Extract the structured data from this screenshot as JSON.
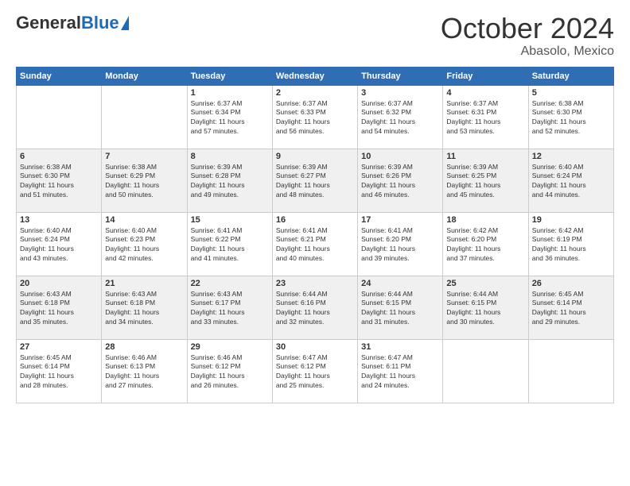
{
  "header": {
    "logo": {
      "general": "General",
      "blue": "Blue"
    },
    "title": "October 2024",
    "location": "Abasolo, Mexico"
  },
  "calendar": {
    "days_of_week": [
      "Sunday",
      "Monday",
      "Tuesday",
      "Wednesday",
      "Thursday",
      "Friday",
      "Saturday"
    ],
    "weeks": [
      [
        {
          "day": "",
          "info": ""
        },
        {
          "day": "",
          "info": ""
        },
        {
          "day": "1",
          "info": "Sunrise: 6:37 AM\nSunset: 6:34 PM\nDaylight: 11 hours\nand 57 minutes."
        },
        {
          "day": "2",
          "info": "Sunrise: 6:37 AM\nSunset: 6:33 PM\nDaylight: 11 hours\nand 56 minutes."
        },
        {
          "day": "3",
          "info": "Sunrise: 6:37 AM\nSunset: 6:32 PM\nDaylight: 11 hours\nand 54 minutes."
        },
        {
          "day": "4",
          "info": "Sunrise: 6:37 AM\nSunset: 6:31 PM\nDaylight: 11 hours\nand 53 minutes."
        },
        {
          "day": "5",
          "info": "Sunrise: 6:38 AM\nSunset: 6:30 PM\nDaylight: 11 hours\nand 52 minutes."
        }
      ],
      [
        {
          "day": "6",
          "info": "Sunrise: 6:38 AM\nSunset: 6:30 PM\nDaylight: 11 hours\nand 51 minutes."
        },
        {
          "day": "7",
          "info": "Sunrise: 6:38 AM\nSunset: 6:29 PM\nDaylight: 11 hours\nand 50 minutes."
        },
        {
          "day": "8",
          "info": "Sunrise: 6:39 AM\nSunset: 6:28 PM\nDaylight: 11 hours\nand 49 minutes."
        },
        {
          "day": "9",
          "info": "Sunrise: 6:39 AM\nSunset: 6:27 PM\nDaylight: 11 hours\nand 48 minutes."
        },
        {
          "day": "10",
          "info": "Sunrise: 6:39 AM\nSunset: 6:26 PM\nDaylight: 11 hours\nand 46 minutes."
        },
        {
          "day": "11",
          "info": "Sunrise: 6:39 AM\nSunset: 6:25 PM\nDaylight: 11 hours\nand 45 minutes."
        },
        {
          "day": "12",
          "info": "Sunrise: 6:40 AM\nSunset: 6:24 PM\nDaylight: 11 hours\nand 44 minutes."
        }
      ],
      [
        {
          "day": "13",
          "info": "Sunrise: 6:40 AM\nSunset: 6:24 PM\nDaylight: 11 hours\nand 43 minutes."
        },
        {
          "day": "14",
          "info": "Sunrise: 6:40 AM\nSunset: 6:23 PM\nDaylight: 11 hours\nand 42 minutes."
        },
        {
          "day": "15",
          "info": "Sunrise: 6:41 AM\nSunset: 6:22 PM\nDaylight: 11 hours\nand 41 minutes."
        },
        {
          "day": "16",
          "info": "Sunrise: 6:41 AM\nSunset: 6:21 PM\nDaylight: 11 hours\nand 40 minutes."
        },
        {
          "day": "17",
          "info": "Sunrise: 6:41 AM\nSunset: 6:20 PM\nDaylight: 11 hours\nand 39 minutes."
        },
        {
          "day": "18",
          "info": "Sunrise: 6:42 AM\nSunset: 6:20 PM\nDaylight: 11 hours\nand 37 minutes."
        },
        {
          "day": "19",
          "info": "Sunrise: 6:42 AM\nSunset: 6:19 PM\nDaylight: 11 hours\nand 36 minutes."
        }
      ],
      [
        {
          "day": "20",
          "info": "Sunrise: 6:43 AM\nSunset: 6:18 PM\nDaylight: 11 hours\nand 35 minutes."
        },
        {
          "day": "21",
          "info": "Sunrise: 6:43 AM\nSunset: 6:18 PM\nDaylight: 11 hours\nand 34 minutes."
        },
        {
          "day": "22",
          "info": "Sunrise: 6:43 AM\nSunset: 6:17 PM\nDaylight: 11 hours\nand 33 minutes."
        },
        {
          "day": "23",
          "info": "Sunrise: 6:44 AM\nSunset: 6:16 PM\nDaylight: 11 hours\nand 32 minutes."
        },
        {
          "day": "24",
          "info": "Sunrise: 6:44 AM\nSunset: 6:15 PM\nDaylight: 11 hours\nand 31 minutes."
        },
        {
          "day": "25",
          "info": "Sunrise: 6:44 AM\nSunset: 6:15 PM\nDaylight: 11 hours\nand 30 minutes."
        },
        {
          "day": "26",
          "info": "Sunrise: 6:45 AM\nSunset: 6:14 PM\nDaylight: 11 hours\nand 29 minutes."
        }
      ],
      [
        {
          "day": "27",
          "info": "Sunrise: 6:45 AM\nSunset: 6:14 PM\nDaylight: 11 hours\nand 28 minutes."
        },
        {
          "day": "28",
          "info": "Sunrise: 6:46 AM\nSunset: 6:13 PM\nDaylight: 11 hours\nand 27 minutes."
        },
        {
          "day": "29",
          "info": "Sunrise: 6:46 AM\nSunset: 6:12 PM\nDaylight: 11 hours\nand 26 minutes."
        },
        {
          "day": "30",
          "info": "Sunrise: 6:47 AM\nSunset: 6:12 PM\nDaylight: 11 hours\nand 25 minutes."
        },
        {
          "day": "31",
          "info": "Sunrise: 6:47 AM\nSunset: 6:11 PM\nDaylight: 11 hours\nand 24 minutes."
        },
        {
          "day": "",
          "info": ""
        },
        {
          "day": "",
          "info": ""
        }
      ]
    ]
  }
}
